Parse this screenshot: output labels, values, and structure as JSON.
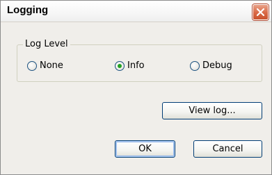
{
  "window": {
    "title": "Logging",
    "close_icon": "close-x-icon"
  },
  "log_level": {
    "label": "Log Level",
    "options": [
      {
        "label": "None",
        "selected": false
      },
      {
        "label": "Info",
        "selected": true
      },
      {
        "label": "Debug",
        "selected": false
      }
    ]
  },
  "buttons": {
    "view_log": "View log...",
    "ok": "OK",
    "cancel": "Cancel"
  },
  "colors": {
    "close_button": "#d96845",
    "radio_selected": "#21a121",
    "button_border": "#003c74"
  }
}
